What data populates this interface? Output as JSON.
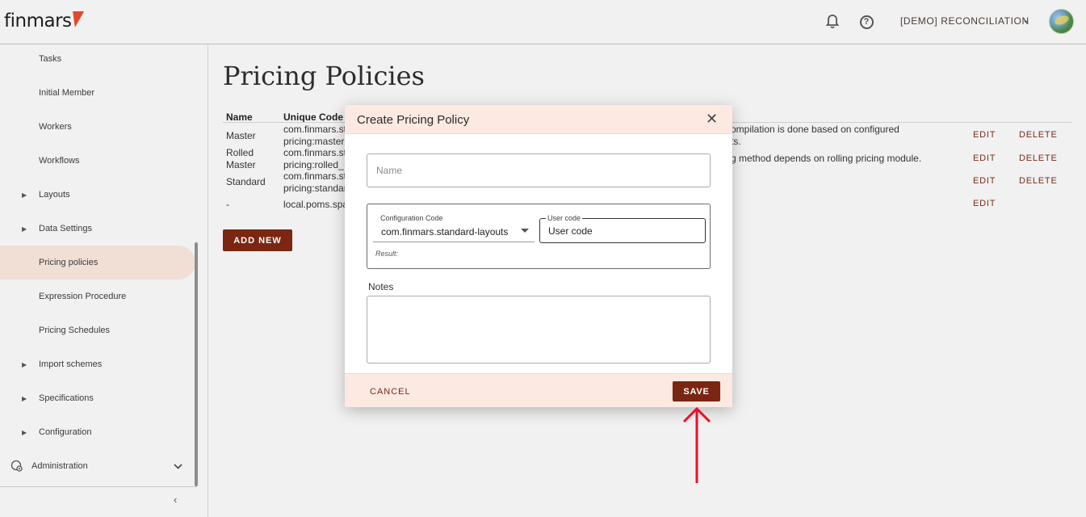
{
  "app": {
    "logo_text": "finmars",
    "workspace": "[DEMO] RECONCILIATION",
    "help_glyph": "?",
    "chevron_glyph": "⌄"
  },
  "sidebar": {
    "items": [
      {
        "label": "Tasks",
        "expandable": false
      },
      {
        "label": "Initial Member",
        "expandable": false
      },
      {
        "label": "Workers",
        "expandable": false
      },
      {
        "label": "Workflows",
        "expandable": false
      },
      {
        "label": "Layouts",
        "expandable": true
      },
      {
        "label": "Data Settings",
        "expandable": true
      },
      {
        "label": "Pricing policies",
        "expandable": false,
        "active": true
      },
      {
        "label": "Expression Procedure",
        "expandable": false
      },
      {
        "label": "Pricing Schedules",
        "expandable": false
      },
      {
        "label": "Import schemes",
        "expandable": true
      },
      {
        "label": "Specifications",
        "expandable": true
      },
      {
        "label": "Configuration",
        "expandable": true
      }
    ],
    "admin_label": "Administration",
    "caret_glyph": "▶",
    "collapse_glyph": "‹"
  },
  "main": {
    "title": "Pricing Policies",
    "columns": {
      "name": "Name",
      "unique_code": "Unique Code"
    },
    "rows": [
      {
        "name": "Master",
        "code_1": "com.finmars.st",
        "code_2": "pricing:master",
        "desc_1": "ompilation is done based on configured",
        "desc_2": "ts.",
        "edit": "EDIT",
        "delete": "DELETE"
      },
      {
        "name_1": "Rolled",
        "name_2": "Master",
        "code_1": "com.finmars.st",
        "code_2": "pricing:rolled_",
        "desc_1": "g method depends on rolling pricing module.",
        "edit": "EDIT",
        "delete": "DELETE"
      },
      {
        "name": "Standard",
        "code_1": "com.finmars.st",
        "code_2": "pricing:standar",
        "edit": "EDIT",
        "delete": "DELETE"
      },
      {
        "name": "-",
        "code_1": "local.poms.spa",
        "edit": "EDIT"
      }
    ],
    "add_new": "ADD NEW"
  },
  "dialog": {
    "title": "Create Pricing Policy",
    "close_glyph": "✕",
    "name_placeholder": "Name",
    "config_code_label": "Configuration Code",
    "config_code_value": "com.finmars.standard-layouts",
    "user_code_label": "User code",
    "user_code_value": "User code",
    "result_label": "Result:",
    "notes_label": "Notes",
    "cancel": "CANCEL",
    "save": "SAVE"
  },
  "colors": {
    "accent": "#7a2612",
    "dialog_header_bg": "#fce9e2",
    "active_nav_bg": "#f1dfd6",
    "annotation_arrow": "#e8102b"
  }
}
